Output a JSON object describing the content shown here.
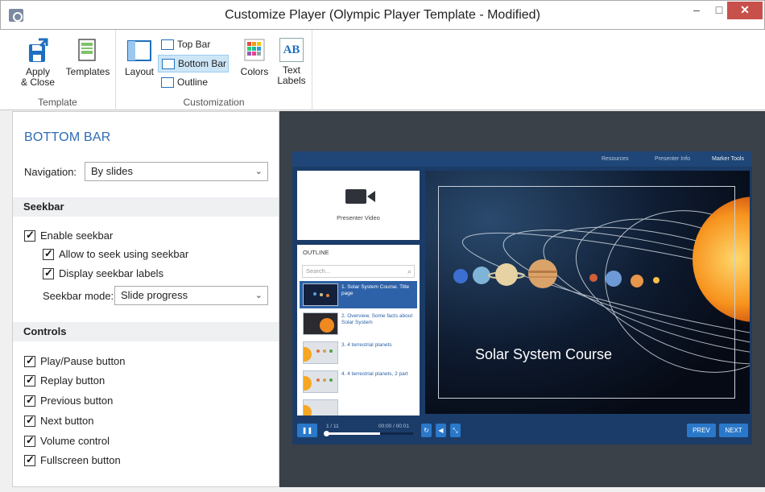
{
  "window": {
    "title": "Customize Player (Olympic Player Template - Modified)",
    "minimize_glyph": "–",
    "maximize_glyph": "□",
    "close_glyph": "✕"
  },
  "ribbon": {
    "apply_close_label": "Apply\n& Close",
    "templates_label": "Templates",
    "template_group_label": "Template",
    "layout_label": "Layout",
    "top_bar_label": "Top Bar",
    "bottom_bar_label": "Bottom Bar",
    "outline_label": "Outline",
    "colors_label": "Colors",
    "text_labels_label": "Text\nLabels",
    "text_labels_icon_text": "AB",
    "customization_group_label": "Customization",
    "active_item": "Bottom Bar"
  },
  "panel": {
    "title": "BOTTOM BAR",
    "navigation_label": "Navigation:",
    "navigation_value": "By slides",
    "seekbar_section": "Seekbar",
    "enable_seekbar": "Enable seekbar",
    "allow_seek": "Allow to seek using seekbar",
    "display_labels": "Display seekbar labels",
    "seekbar_mode_label": "Seekbar mode:",
    "seekbar_mode_value": "Slide progress",
    "controls_section": "Controls",
    "controls": [
      "Play/Pause button",
      "Replay button",
      "Previous button",
      "Next button",
      "Volume control",
      "Fullscreen button"
    ]
  },
  "preview": {
    "top_links": [
      "Resources",
      "Presenter Info",
      "Marker Tools"
    ],
    "video_label": "Presenter Video",
    "outline_title": "OUTLINE",
    "search_placeholder": "Search...",
    "outline_items": [
      "1. Solar System Course. Title page",
      "2. Overview. Some facts about Solar System",
      "3. 4 terrestrial planets",
      "4. 4 terrestrial planets, 2 part"
    ],
    "slide_title": "Solar System Course",
    "slide_counter": "1 / 11",
    "time_display": "00:00 / 00:01",
    "seek_progress": 0.62,
    "prev_label": "PREV",
    "next_label": "NEXT",
    "accent_color": "#2a78c9"
  }
}
